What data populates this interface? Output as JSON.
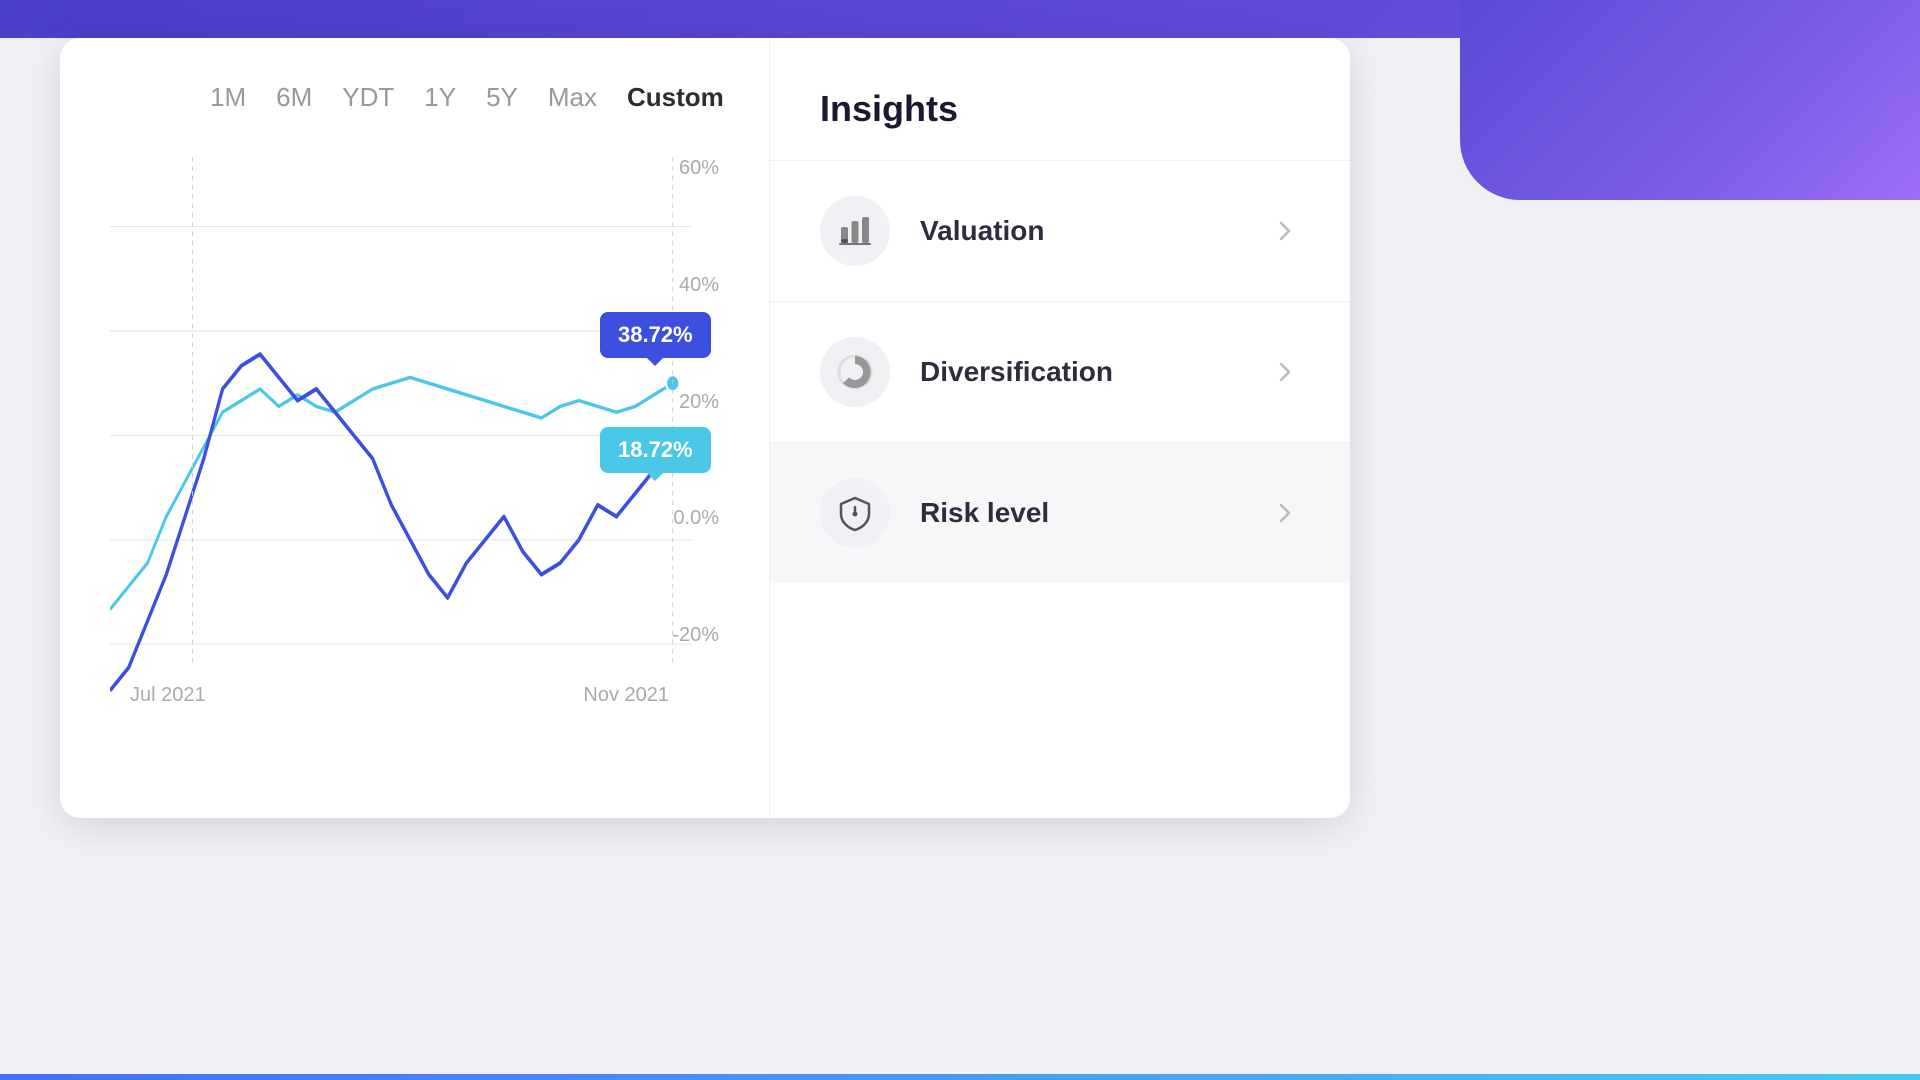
{
  "topBar": {
    "label": "top-bar"
  },
  "chart": {
    "timeFilters": [
      {
        "label": "1M",
        "active": false
      },
      {
        "label": "6M",
        "active": false
      },
      {
        "label": "YDT",
        "active": false
      },
      {
        "label": "1Y",
        "active": false
      },
      {
        "label": "5Y",
        "active": false
      },
      {
        "label": "Max",
        "active": false
      },
      {
        "label": "Custom",
        "active": true
      }
    ],
    "yLabels": [
      "60%",
      "40%",
      "20%",
      "0.0%",
      "-20%"
    ],
    "xLabels": [
      "Jul 2021",
      "Nov 2021"
    ],
    "tooltip1": {
      "value": "38.72%",
      "color": "#3d4fde"
    },
    "tooltip2": {
      "value": "18.72%",
      "color": "#4bc8e8"
    }
  },
  "insights": {
    "title": "Insights",
    "items": [
      {
        "label": "Valuation",
        "icon": "bar-chart-icon",
        "active": false
      },
      {
        "label": "Diversification",
        "icon": "pie-chart-icon",
        "active": false
      },
      {
        "label": "Risk level",
        "icon": "shield-icon",
        "active": true
      }
    ]
  }
}
